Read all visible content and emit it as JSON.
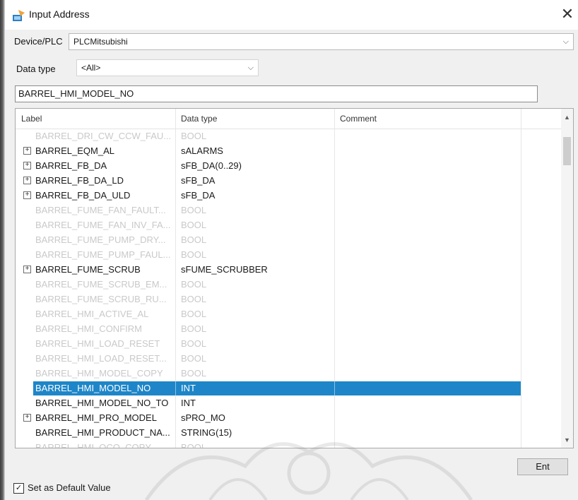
{
  "window": {
    "title": "Input Address",
    "close_glyph": "✕"
  },
  "device": {
    "label": "Device/PLC",
    "value": "PLCMitsubishi"
  },
  "data_type_filter": {
    "label": "Data type",
    "value": "<All>"
  },
  "address_input": {
    "value": "BARREL_HMI_MODEL_NO"
  },
  "grid": {
    "columns": [
      "Label",
      "Data type",
      "Comment"
    ],
    "rows": [
      {
        "label": "BARREL_DRI_CW_CCW_FAU...",
        "type": "BOOL",
        "expandable": false,
        "disabled": true
      },
      {
        "label": "BARREL_EQM_AL",
        "type": "sALARMS",
        "expandable": true,
        "disabled": false
      },
      {
        "label": "BARREL_FB_DA",
        "type": "sFB_DA(0..29)",
        "expandable": true,
        "disabled": false
      },
      {
        "label": "BARREL_FB_DA_LD",
        "type": "sFB_DA",
        "expandable": true,
        "disabled": false
      },
      {
        "label": "BARREL_FB_DA_ULD",
        "type": "sFB_DA",
        "expandable": true,
        "disabled": false
      },
      {
        "label": "BARREL_FUME_FAN_FAULT...",
        "type": "BOOL",
        "expandable": false,
        "disabled": true
      },
      {
        "label": "BARREL_FUME_FAN_INV_FA...",
        "type": "BOOL",
        "expandable": false,
        "disabled": true
      },
      {
        "label": "BARREL_FUME_PUMP_DRY...",
        "type": "BOOL",
        "expandable": false,
        "disabled": true
      },
      {
        "label": "BARREL_FUME_PUMP_FAUL...",
        "type": "BOOL",
        "expandable": false,
        "disabled": true
      },
      {
        "label": "BARREL_FUME_SCRUB",
        "type": "sFUME_SCRUBBER",
        "expandable": true,
        "disabled": false
      },
      {
        "label": "BARREL_FUME_SCRUB_EM...",
        "type": "BOOL",
        "expandable": false,
        "disabled": true
      },
      {
        "label": "BARREL_FUME_SCRUB_RU...",
        "type": "BOOL",
        "expandable": false,
        "disabled": true
      },
      {
        "label": "BARREL_HMI_ACTIVE_AL",
        "type": "BOOL",
        "expandable": false,
        "disabled": true
      },
      {
        "label": "BARREL_HMI_CONFIRM",
        "type": "BOOL",
        "expandable": false,
        "disabled": true
      },
      {
        "label": "BARREL_HMI_LOAD_RESET",
        "type": "BOOL",
        "expandable": false,
        "disabled": true
      },
      {
        "label": "BARREL_HMI_LOAD_RESET...",
        "type": "BOOL",
        "expandable": false,
        "disabled": true
      },
      {
        "label": "BARREL_HMI_MODEL_COPY",
        "type": "BOOL",
        "expandable": false,
        "disabled": true
      },
      {
        "label": "BARREL_HMI_MODEL_NO",
        "type": "INT",
        "expandable": false,
        "disabled": false,
        "selected": true
      },
      {
        "label": "BARREL_HMI_MODEL_NO_TO",
        "type": "INT",
        "expandable": false,
        "disabled": false
      },
      {
        "label": "BARREL_HMI_PRO_MODEL",
        "type": "sPRO_MO",
        "expandable": true,
        "disabled": false
      },
      {
        "label": "BARREL_HMI_PRODUCT_NA...",
        "type": "STRING(15)",
        "expandable": false,
        "disabled": false
      },
      {
        "label": "BARREL_HMI_QCO_COPY",
        "type": "BOOL",
        "expandable": false,
        "disabled": true
      }
    ]
  },
  "buttons": {
    "ent_label": "Ent"
  },
  "default_checkbox": {
    "label": "Set as Default Value",
    "checked": true
  },
  "colors": {
    "selection": "#1e86c8",
    "disabled_text": "#c9c9c9"
  }
}
